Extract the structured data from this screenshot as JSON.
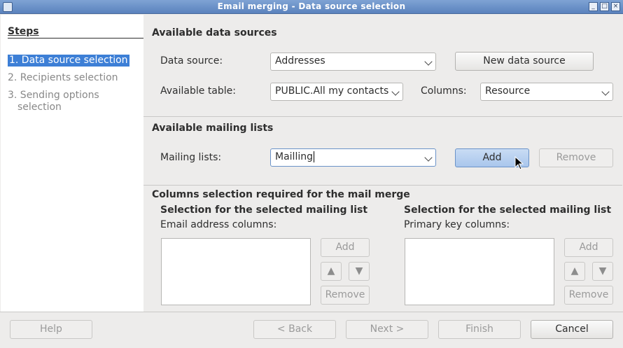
{
  "window": {
    "title": "Email merging - Data source selection"
  },
  "steps": {
    "title": "Steps",
    "items": [
      {
        "label": "1. Data source selection"
      },
      {
        "label": "2. Recipients selection"
      },
      {
        "label": "3. Sending options"
      },
      {
        "label": "selection"
      }
    ]
  },
  "datasources": {
    "heading": "Available data sources",
    "data_source_label": "Data source:",
    "data_source_value": "Addresses",
    "new_source_button": "New data source",
    "table_label": "Available table:",
    "table_value": "PUBLIC.All my contacts",
    "columns_label": "Columns:",
    "columns_value": "Resource"
  },
  "mailing": {
    "heading": "Available mailing lists",
    "lists_label": "Mailing lists:",
    "lists_value": "Mailling",
    "add_button": "Add",
    "remove_button": "Remove"
  },
  "columns_selection": {
    "heading": "Columns selection required for the mail merge",
    "left": {
      "subheading": "Selection for the selected mailing list",
      "label": "Email address columns:",
      "add": "Add",
      "up": "▲",
      "down": "▼",
      "remove": "Remove"
    },
    "right": {
      "subheading": "Selection for the selected mailing list",
      "label": "Primary key columns:",
      "add": "Add",
      "up": "▲",
      "down": "▼",
      "remove": "Remove"
    }
  },
  "footer": {
    "help": "Help",
    "back": "< Back",
    "next": "Next >",
    "finish": "Finish",
    "cancel": "Cancel"
  }
}
